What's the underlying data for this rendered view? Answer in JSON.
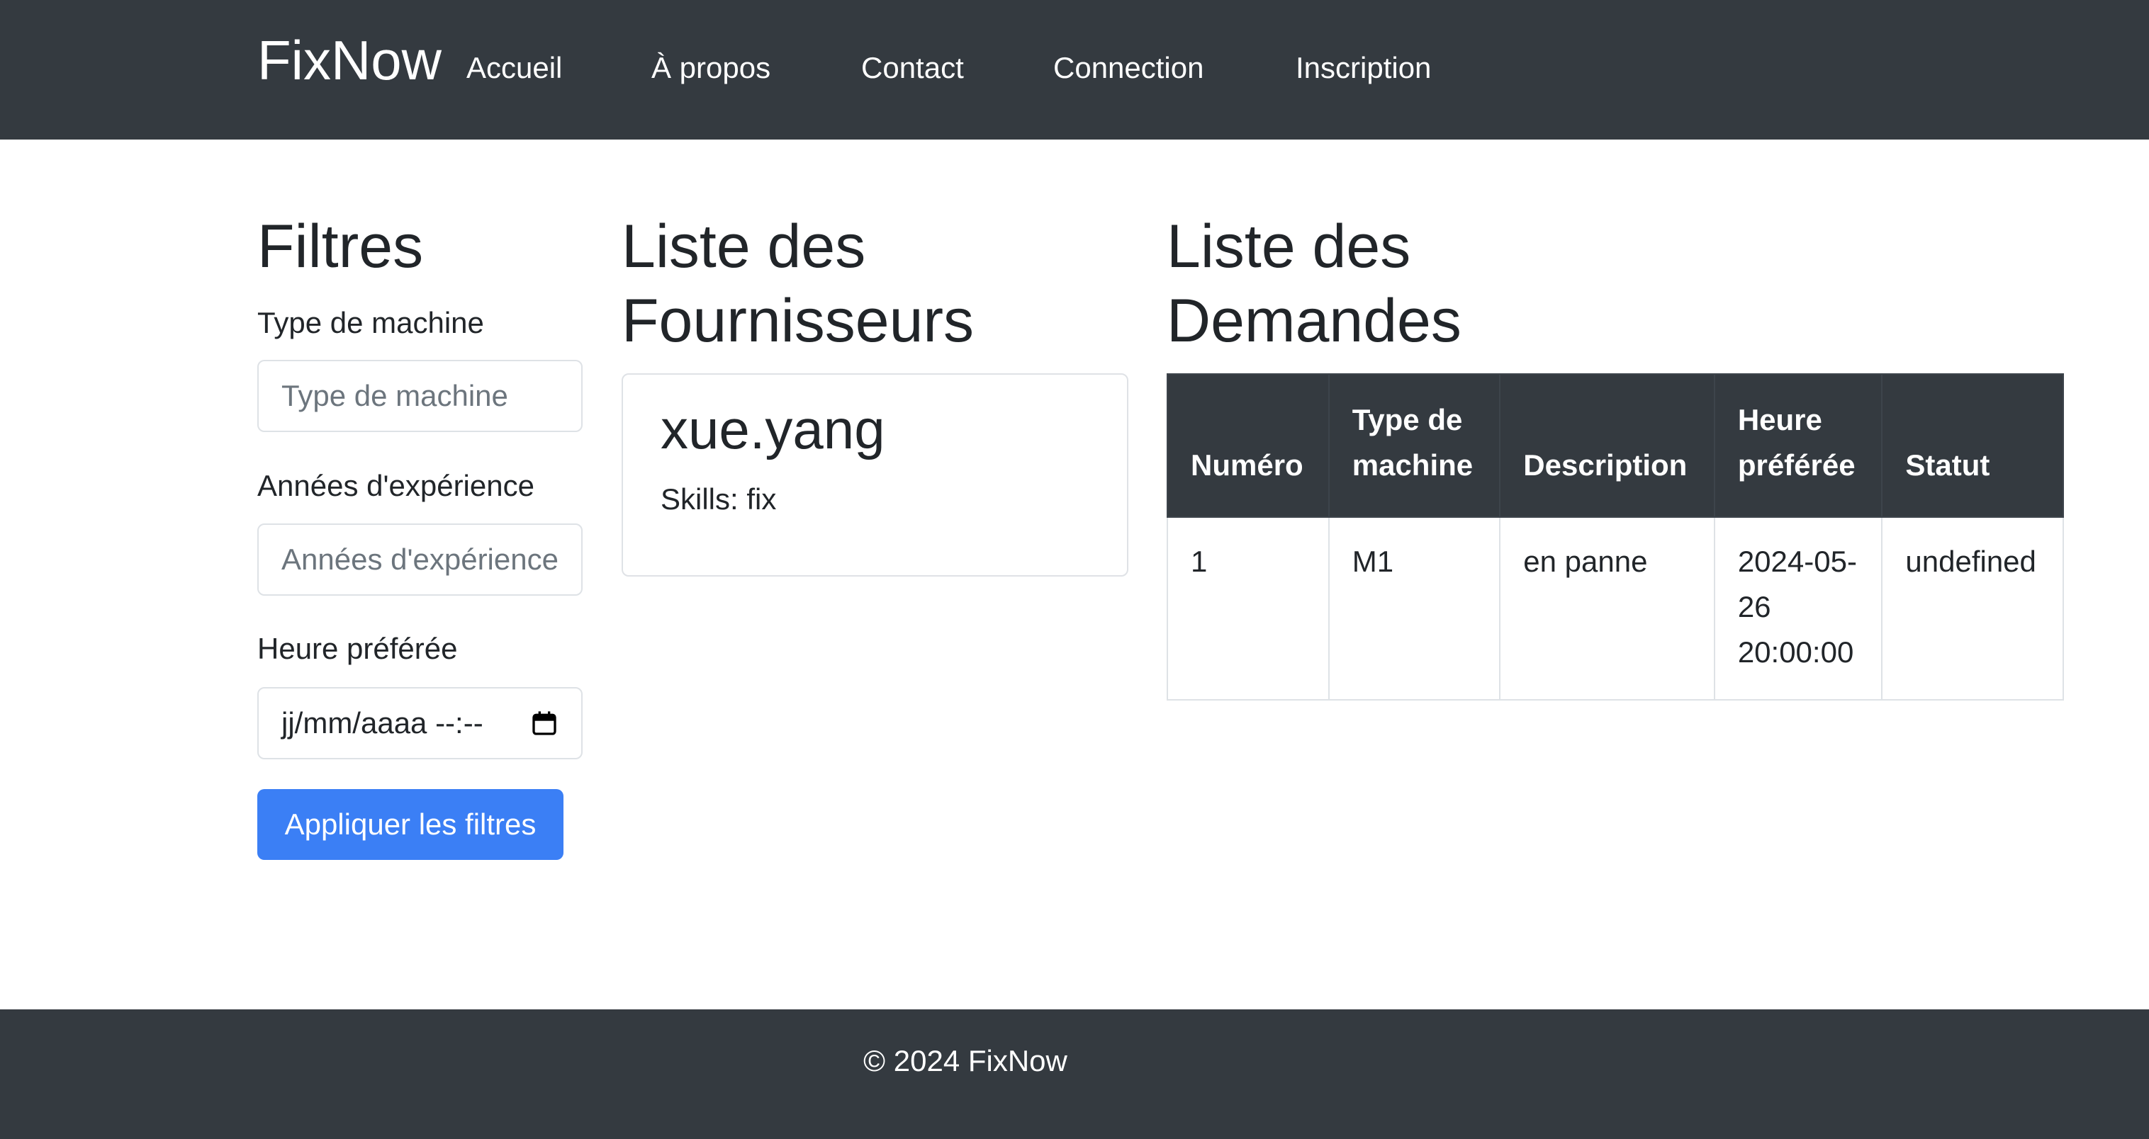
{
  "navbar": {
    "brand": "FixNow",
    "links": {
      "accueil": "Accueil",
      "apropos": "À propos",
      "contact": "Contact",
      "connection": "Connection",
      "inscription": "Inscription"
    }
  },
  "filters": {
    "title": "Filtres",
    "machine_type_label": "Type de machine",
    "machine_type_placeholder": "Type de machine",
    "experience_label": "Années d'expérience",
    "experience_placeholder": "Années d'expérience",
    "preferred_time_label": "Heure préférée",
    "preferred_time_placeholder": "jj/mm/aaaa --:--",
    "apply_button": "Appliquer les filtres"
  },
  "suppliers": {
    "title": "Liste des Fournisseurs",
    "items": [
      {
        "name": "xue.yang",
        "skills": "Skills: fix"
      }
    ]
  },
  "requests": {
    "title": "Liste des Demandes",
    "columns": [
      "Numéro",
      "Type de machine",
      "Description",
      "Heure préférée",
      "Statut"
    ],
    "rows": [
      [
        "1",
        "M1",
        "en panne",
        "2024-05-26 20:00:00",
        "undefined"
      ]
    ]
  },
  "footer": {
    "text": "© 2024 FixNow"
  }
}
